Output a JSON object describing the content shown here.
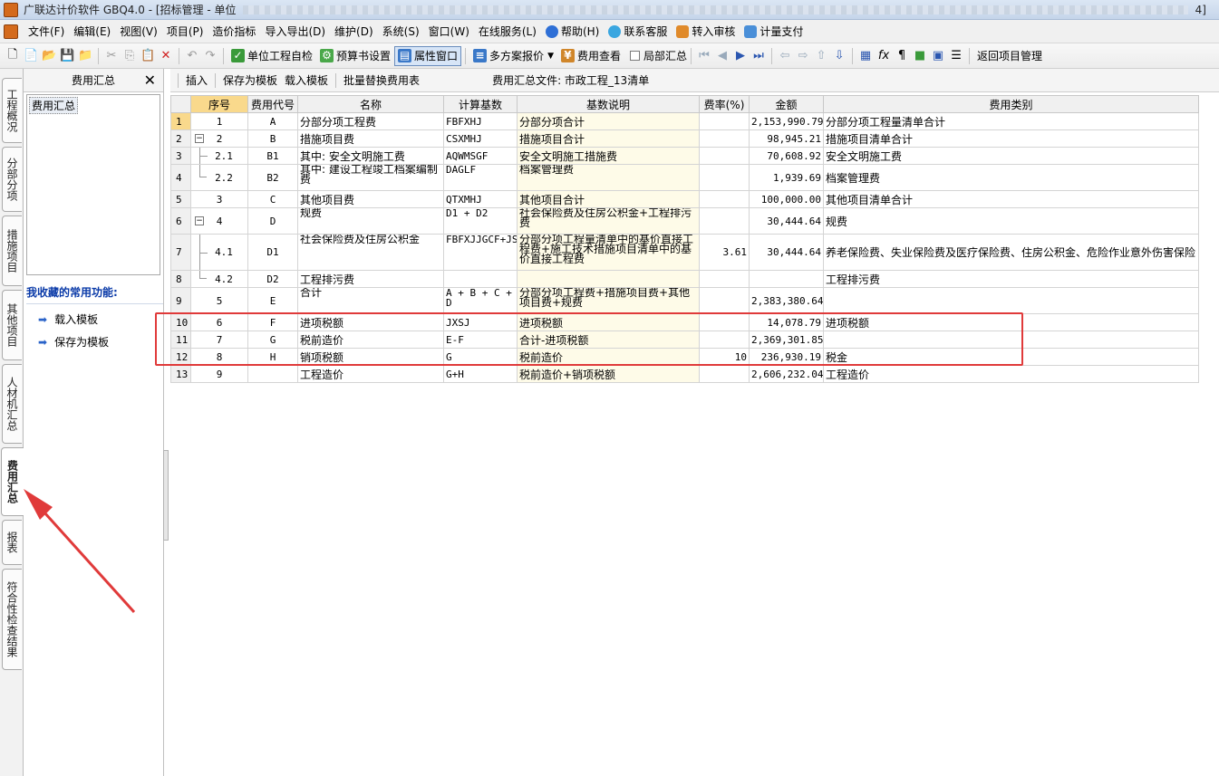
{
  "window": {
    "title": "广联达计价软件 GBQ4.0 - [招标管理 - 单位",
    "title_suffix": "4]"
  },
  "menu": [
    {
      "label": "文件(F)"
    },
    {
      "label": "编辑(E)"
    },
    {
      "label": "视图(V)"
    },
    {
      "label": "项目(P)"
    },
    {
      "label": "造价指标"
    },
    {
      "label": "导入导出(D)"
    },
    {
      "label": "维护(D)"
    },
    {
      "label": "系统(S)"
    },
    {
      "label": "窗口(W)"
    },
    {
      "label": "在线服务(L)"
    },
    {
      "label": "帮助(H)",
      "icon": "help-icon"
    },
    {
      "label": "联系客服",
      "icon": "service-icon"
    },
    {
      "label": "转入审核",
      "icon": "audit-icon"
    },
    {
      "label": "计量支付",
      "icon": "payment-icon"
    }
  ],
  "toolbar": {
    "self_check": "单位工程自检",
    "budget_settings": "预算书设置",
    "property_window": "属性窗口",
    "multi_plan_quote": "多方案报价",
    "fee_view": "费用查看",
    "local_summary": "局部汇总",
    "back_to_project": "返回项目管理"
  },
  "vertical_tabs": [
    {
      "label": "工程概况"
    },
    {
      "label": "分部分项"
    },
    {
      "label": "措施项目"
    },
    {
      "label": "其他项目"
    },
    {
      "label": "人材机汇总"
    },
    {
      "label": "费用汇总",
      "active": true
    },
    {
      "label": "报表"
    },
    {
      "label": "符合性检查结果"
    }
  ],
  "side_panel": {
    "title": "费用汇总",
    "tree_root": "费用汇总",
    "favorites_title": "我收藏的常用功能:",
    "favorites": [
      {
        "label": "载入模板"
      },
      {
        "label": "保存为模板"
      }
    ]
  },
  "main_toolbar": {
    "insert": "插入",
    "save_template": "保存为模板",
    "load_template": "载入模板",
    "batch_replace": "批量替换费用表",
    "file_label": "费用汇总文件: 市政工程_13清单"
  },
  "table": {
    "headers": [
      "",
      "序号",
      "费用代号",
      "名称",
      "计算基数",
      "基数说明",
      "费率(%)",
      "金额",
      "费用类别"
    ],
    "rows": [
      {
        "rn": "1",
        "seq": "1",
        "code": "A",
        "name": "分部分项工程费",
        "base": "FBFXHJ",
        "desc": "分部分项合计",
        "rate": "",
        "amount": "2,153,990.79",
        "category": "分部分项工程量清单合计",
        "tree": "none",
        "selected": true
      },
      {
        "rn": "2",
        "seq": "2",
        "code": "B",
        "name": "措施项目费",
        "base": "CSXMHJ",
        "desc": "措施项目合计",
        "rate": "",
        "amount": "98,945.21",
        "category": "措施项目清单合计",
        "tree": "parent"
      },
      {
        "rn": "3",
        "seq": "2.1",
        "code": "B1",
        "name": "其中: 安全文明施工费",
        "base": "AQWMSGF",
        "desc": "安全文明施工措施费",
        "rate": "",
        "amount": "70,608.92",
        "category": "安全文明施工费",
        "tree": "mid"
      },
      {
        "rn": "4",
        "seq": "2.2",
        "code": "B2",
        "name": "其中: 建设工程竣工档案编制费",
        "base": "DAGLF",
        "desc": "档案管理费",
        "rate": "",
        "amount": "1,939.69",
        "category": "档案管理费",
        "tree": "end",
        "tall": "2"
      },
      {
        "rn": "5",
        "seq": "3",
        "code": "C",
        "name": "其他项目费",
        "base": "QTXMHJ",
        "desc": "其他项目合计",
        "rate": "",
        "amount": "100,000.00",
        "category": "其他项目清单合计",
        "tree": "none"
      },
      {
        "rn": "6",
        "seq": "4",
        "code": "D",
        "name": "规费",
        "base": "D1 + D2",
        "desc": "社会保险费及住房公积金+工程排污费",
        "rate": "",
        "amount": "30,444.64",
        "category": "规费",
        "tree": "parent",
        "tall": "2"
      },
      {
        "rn": "7",
        "seq": "4.1",
        "code": "D1",
        "name": "社会保险费及住房公积金",
        "base": "FBFXJJGCF+JSCSJJGCF",
        "desc": "分部分项工程量清单中的基价直接工程费+施工技术措施项目清单中的基价直接工程费",
        "rate": "3.61",
        "amount": "30,444.64",
        "category": "养老保险费、失业保险费及医疗保险费、住房公积金、危险作业意外伤害保险",
        "tree": "mid",
        "tall": "3"
      },
      {
        "rn": "8",
        "seq": "4.2",
        "code": "D2",
        "name": "工程排污费",
        "base": "",
        "desc": "",
        "rate": "",
        "amount": "",
        "category": "工程排污费",
        "tree": "end"
      },
      {
        "rn": "9",
        "seq": "5",
        "code": "E",
        "name": "合计",
        "base": "A + B + C + D",
        "desc": "分部分项工程费+措施项目费+其他项目费+规费",
        "rate": "",
        "amount": "2,383,380.64",
        "category": "",
        "tree": "none",
        "tall": "2"
      },
      {
        "rn": "10",
        "seq": "6",
        "code": "F",
        "name": "进项税额",
        "base": "JXSJ",
        "desc": "进项税额",
        "rate": "",
        "amount": "14,078.79",
        "category": "进项税额",
        "tree": "none"
      },
      {
        "rn": "11",
        "seq": "7",
        "code": "G",
        "name": "税前造价",
        "base": "E-F",
        "desc": "合计-进项税额",
        "rate": "",
        "amount": "2,369,301.85",
        "category": "",
        "tree": "none"
      },
      {
        "rn": "12",
        "seq": "8",
        "code": "H",
        "name": "销项税额",
        "base": "G",
        "desc": "税前造价",
        "rate": "10",
        "amount": "236,930.19",
        "category": "税金",
        "tree": "none"
      },
      {
        "rn": "13",
        "seq": "9",
        "code": "",
        "name": "工程造价",
        "base": "G+H",
        "desc": "税前造价+销项税额",
        "rate": "",
        "amount": "2,606,232.04",
        "category": "工程造价",
        "tree": "none"
      }
    ]
  },
  "colors": {
    "annotation": "#e03a3a",
    "selected_header": "#f9d98c",
    "desc_column_bg": "#fefbe8"
  }
}
